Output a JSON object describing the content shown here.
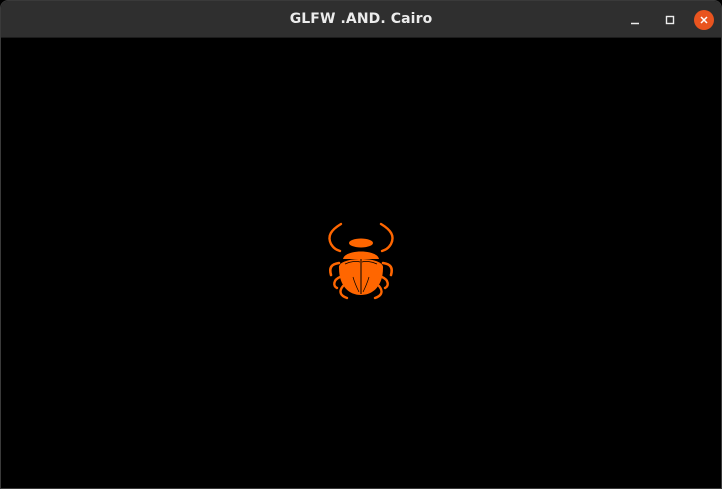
{
  "window": {
    "title": "GLFW .AND. Cairo"
  },
  "controls": {
    "minimize_icon": "minimize-icon",
    "maximize_icon": "maximize-icon",
    "close_icon": "close-icon"
  },
  "colors": {
    "titlebar": "#2f2f2f",
    "title_text": "#ececec",
    "close_button": "#e9541f",
    "canvas_background": "#000000",
    "scarab": "#ff6600"
  },
  "canvas": {
    "figure_icon": "scarab-beetle-icon"
  }
}
